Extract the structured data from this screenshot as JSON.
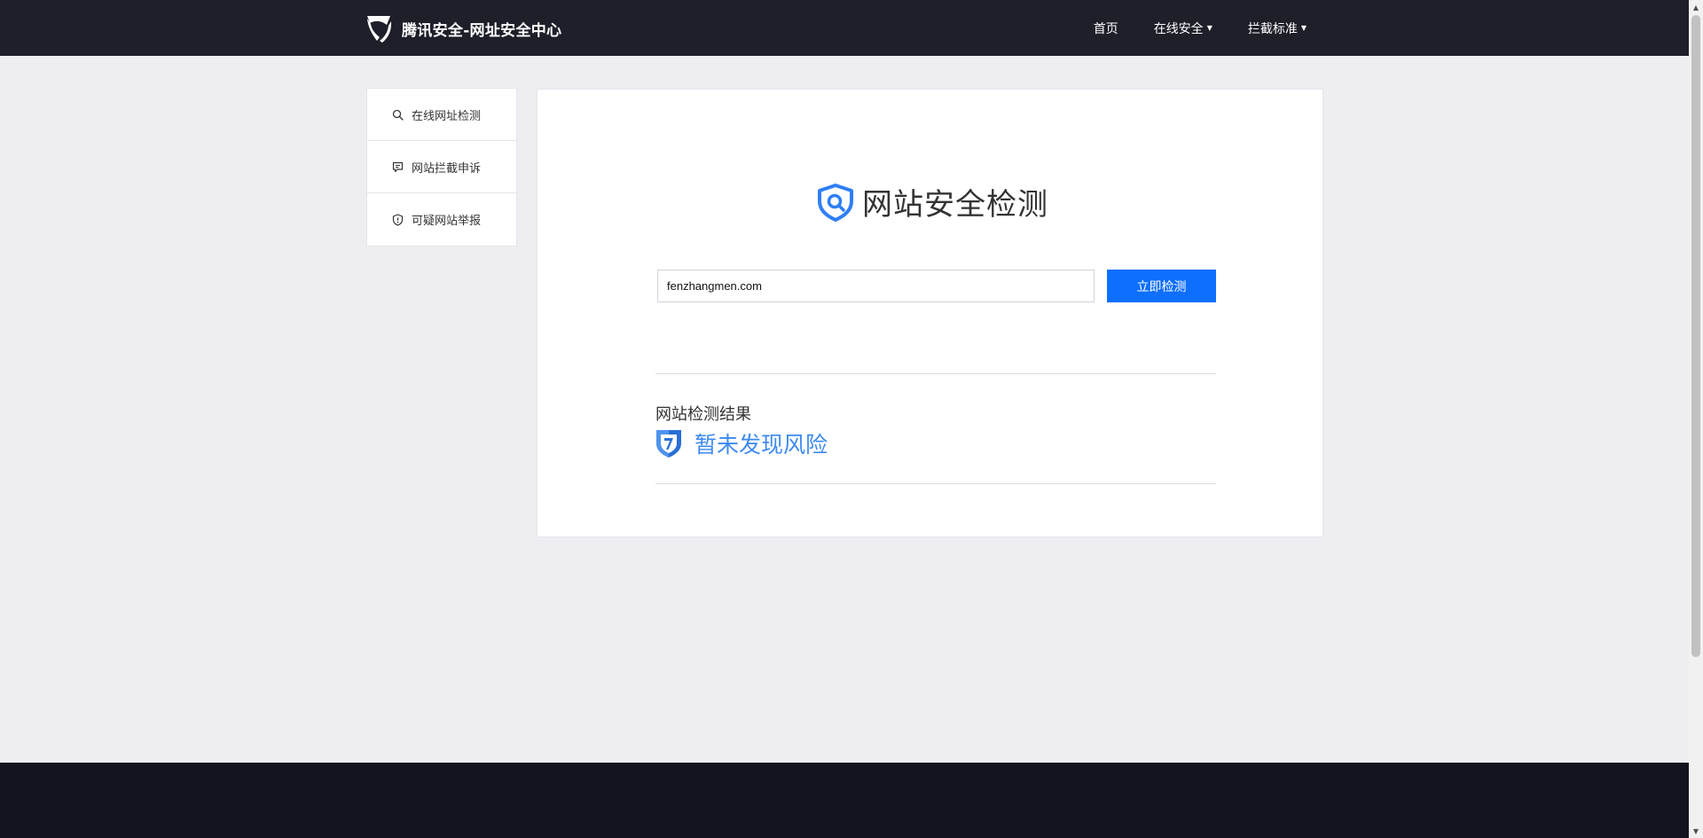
{
  "header": {
    "brand_text": "腾讯安全-网址安全中心",
    "nav": [
      {
        "label": "首页",
        "has_dropdown": false
      },
      {
        "label": "在线安全",
        "has_dropdown": true
      },
      {
        "label": "拦截标准",
        "has_dropdown": true
      }
    ]
  },
  "sidebar": {
    "items": [
      {
        "label": "在线网址检测",
        "icon": "search-icon"
      },
      {
        "label": "网站拦截申诉",
        "icon": "message-icon"
      },
      {
        "label": "可疑网站举报",
        "icon": "shield-alert-icon"
      }
    ]
  },
  "main": {
    "title": "网站安全检测",
    "input_value": "fenzhangmen.com",
    "button_label": "立即检测",
    "result_label": "网站检测结果",
    "result_status": "暂未发现风险"
  },
  "colors": {
    "header_bg": "#1e1f29",
    "footer_bg": "#13141f",
    "page_bg": "#eeeef2",
    "accent_button": "#0e6ffe",
    "result_text": "#3d8af0"
  }
}
